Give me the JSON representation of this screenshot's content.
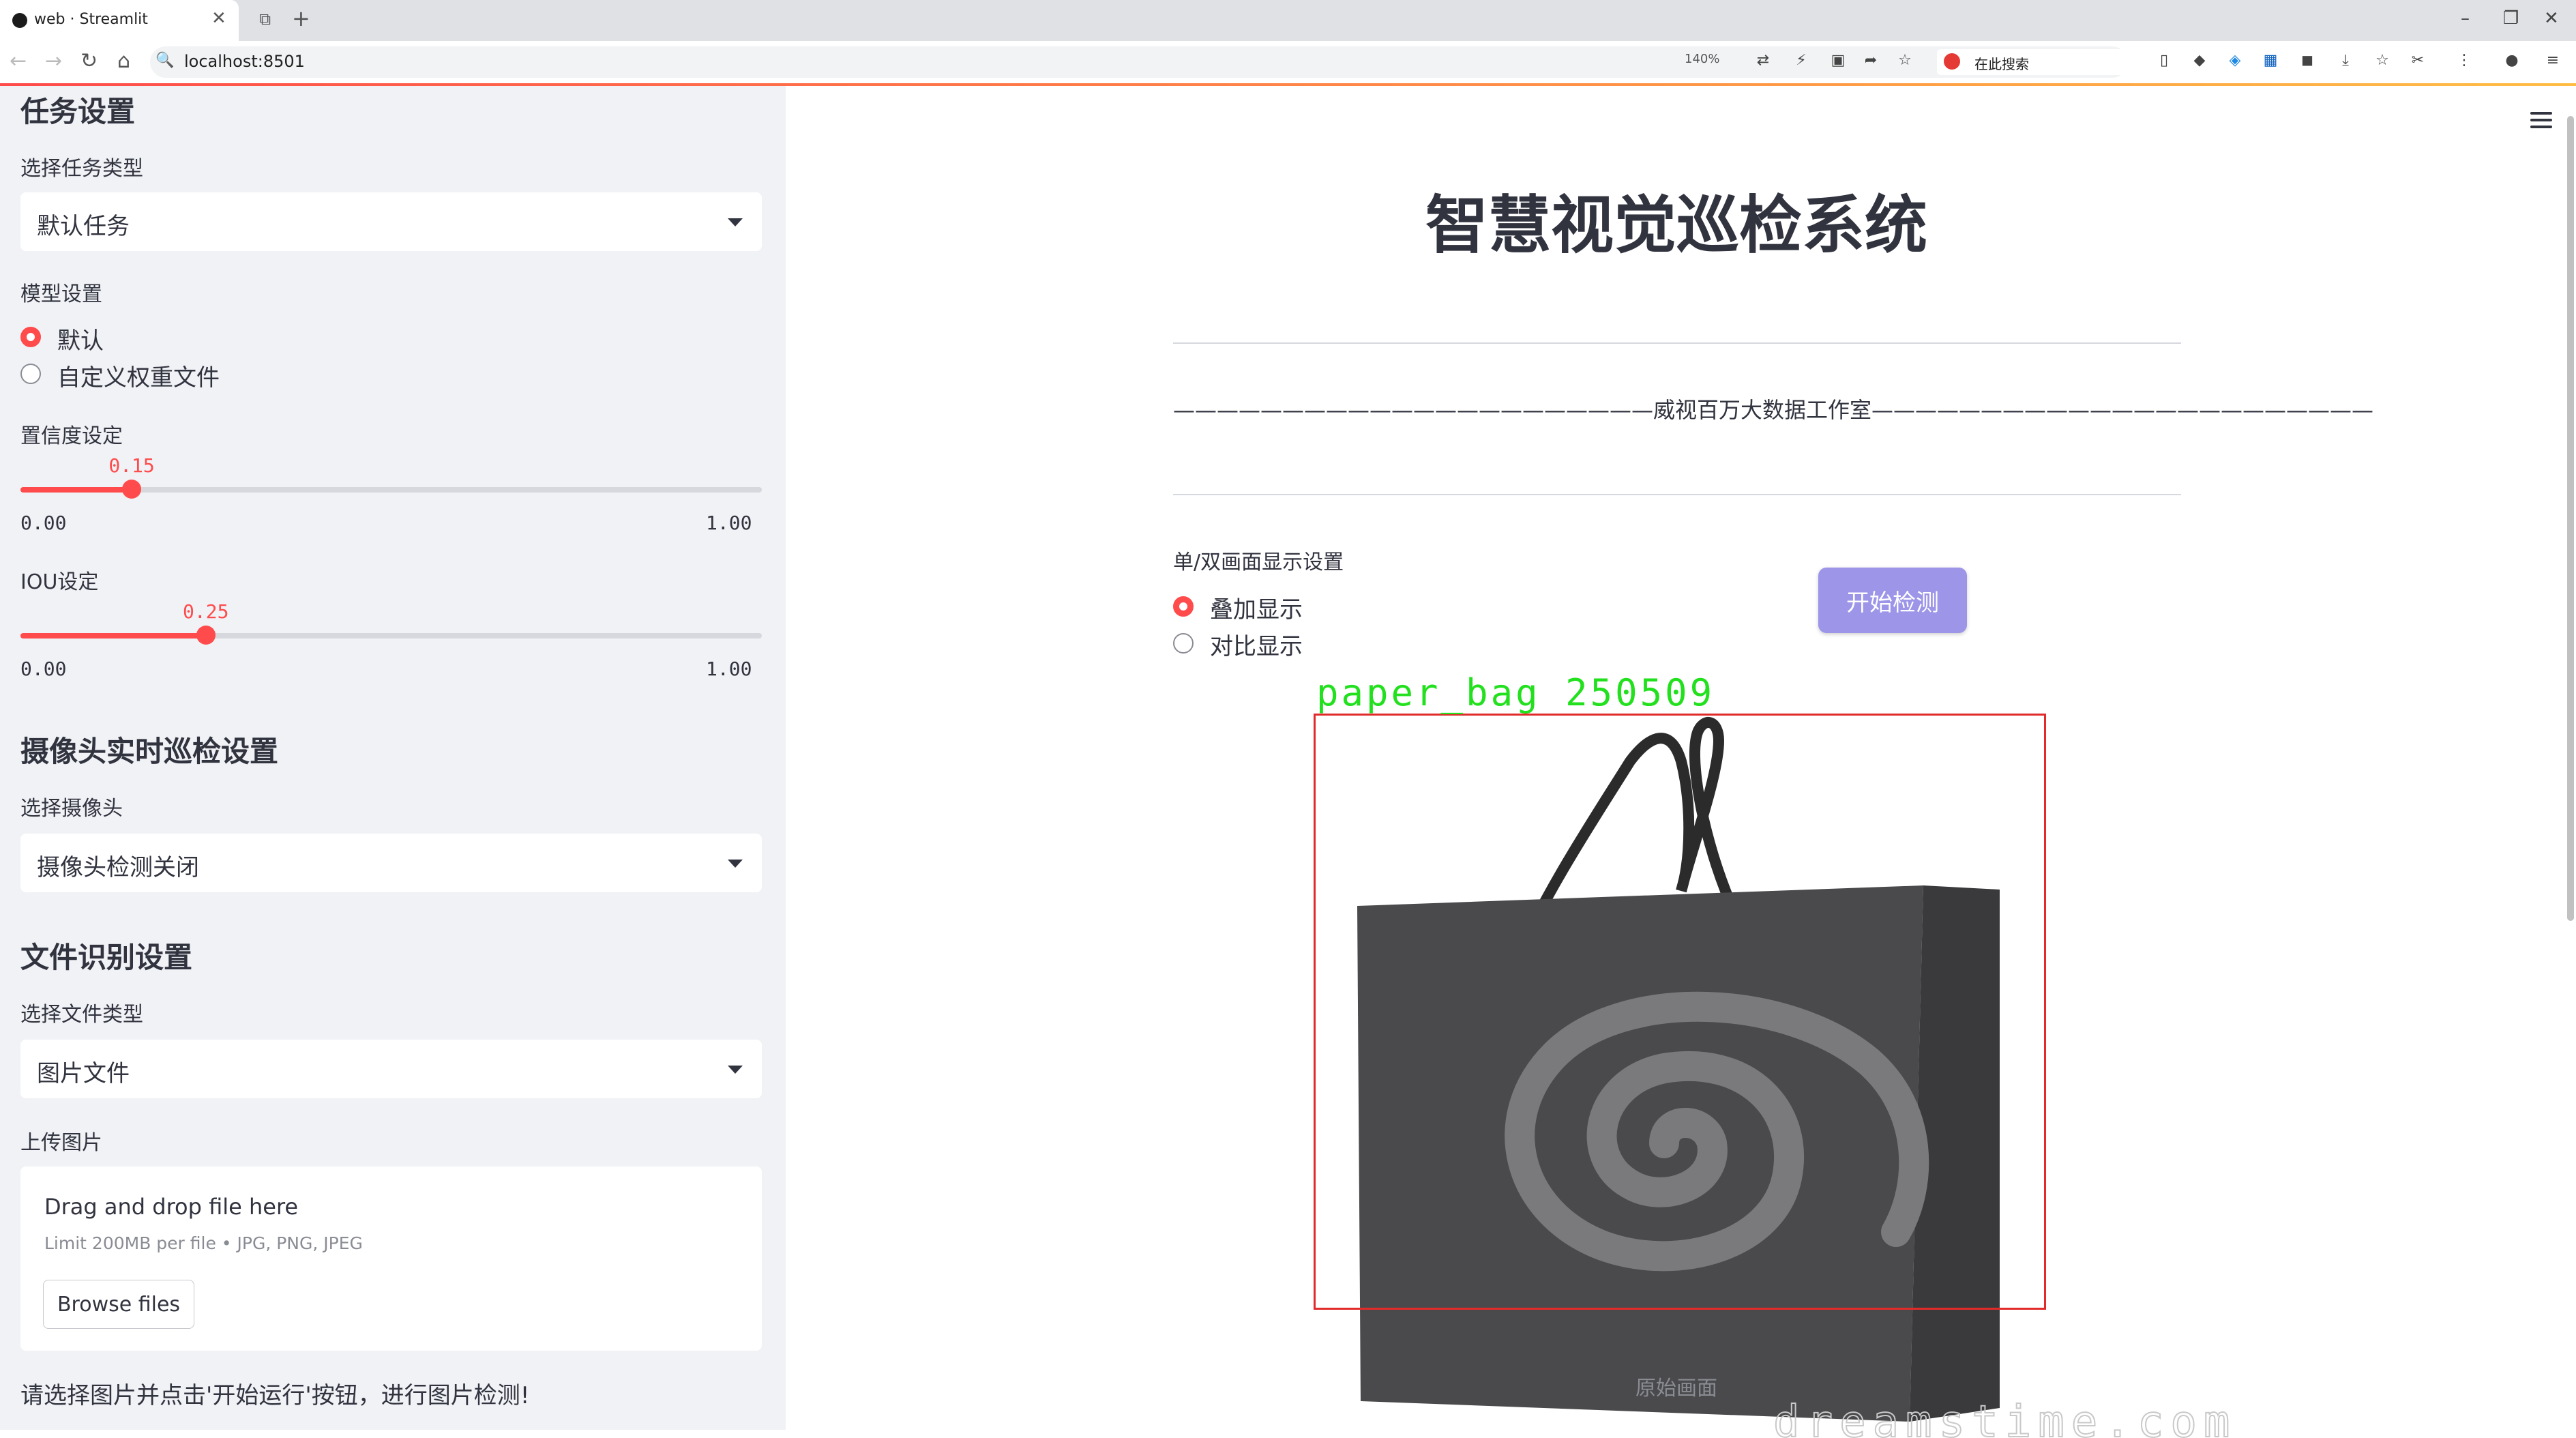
{
  "browser": {
    "tab_title": "web · Streamlit",
    "url": "localhost:8501",
    "zoom": "140%",
    "search_text": "在此搜索"
  },
  "sidebar": {
    "task_section": "任务设置",
    "task_type_label": "选择任务类型",
    "task_type_value": "默认任务",
    "model_label": "模型设置",
    "model_options": [
      "默认",
      "自定义权重文件"
    ],
    "model_selected": 0,
    "conf_label": "置信度设定",
    "conf_value": "0.15",
    "conf_level": 0.15,
    "conf_min": "0.00",
    "conf_max": "1.00",
    "iou_label": "IOU设定",
    "iou_value": "0.25",
    "iou_level": 0.25,
    "iou_min": "0.00",
    "iou_max": "1.00",
    "camera_section": "摄像头实时巡检设置",
    "camera_label": "选择摄像头",
    "camera_value": "摄像头检测关闭",
    "file_section": "文件识别设置",
    "file_type_label": "选择文件类型",
    "file_type_value": "图片文件",
    "upload_label": "上传图片",
    "upload_title": "Drag and drop file here",
    "upload_limit": "Limit 200MB per file • JPG, PNG, JPEG",
    "browse_label": "Browse files",
    "hint": "请选择图片并点击'开始运行'按钮，进行图片检测!"
  },
  "main": {
    "title": "智慧视觉巡检系统",
    "subtitle": "——————————————————————威视百万大数据工作室———————————————————————",
    "display_label": "单/双画面显示设置",
    "display_options": [
      "叠加显示",
      "对比显示"
    ],
    "display_selected": 0,
    "start_button": "开始检测",
    "detection_label": "paper_bag  250509",
    "watermark": "dreamstime.com",
    "caption": "原始画面"
  },
  "colors": {
    "accent": "#ff4b4b",
    "sidebar_bg": "#f0f2f6",
    "button_purple": "#9c95e8",
    "box_red": "#e12a2a",
    "label_green": "#22e01e"
  }
}
